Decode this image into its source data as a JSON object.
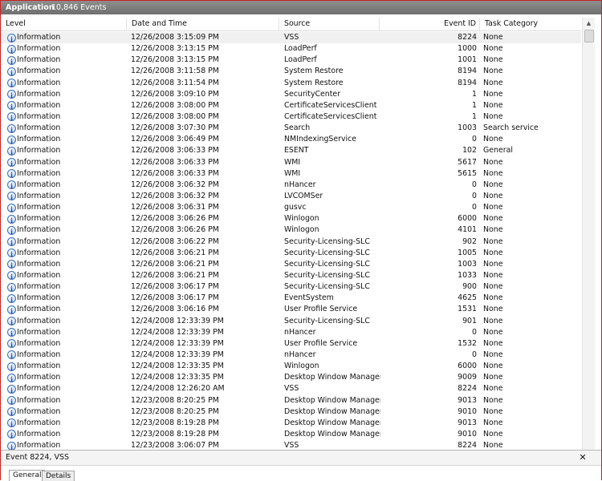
{
  "titlebar": {
    "app": "Application",
    "count": "10,846 Events"
  },
  "columns": {
    "level": "Level",
    "date": "Date and Time",
    "source": "Source",
    "event_id": "Event ID",
    "task": "Task Category"
  },
  "rows": [
    [
      "Information",
      "12/26/2008 3:15:09 PM",
      "VSS",
      "8224",
      "None"
    ],
    [
      "Information",
      "12/26/2008 3:13:15 PM",
      "LoadPerf",
      "1000",
      "None"
    ],
    [
      "Information",
      "12/26/2008 3:13:15 PM",
      "LoadPerf",
      "1001",
      "None"
    ],
    [
      "Information",
      "12/26/2008 3:11:58 PM",
      "System Restore",
      "8194",
      "None"
    ],
    [
      "Information",
      "12/26/2008 3:11:54 PM",
      "System Restore",
      "8194",
      "None"
    ],
    [
      "Information",
      "12/26/2008 3:09:10 PM",
      "SecurityCenter",
      "1",
      "None"
    ],
    [
      "Information",
      "12/26/2008 3:08:00 PM",
      "CertificateServicesClient",
      "1",
      "None"
    ],
    [
      "Information",
      "12/26/2008 3:08:00 PM",
      "CertificateServicesClient",
      "1",
      "None"
    ],
    [
      "Information",
      "12/26/2008 3:07:30 PM",
      "Search",
      "1003",
      "Search service"
    ],
    [
      "Information",
      "12/26/2008 3:06:49 PM",
      "NMIndexingService",
      "0",
      "None"
    ],
    [
      "Information",
      "12/26/2008 3:06:33 PM",
      "ESENT",
      "102",
      "General"
    ],
    [
      "Information",
      "12/26/2008 3:06:33 PM",
      "WMI",
      "5617",
      "None"
    ],
    [
      "Information",
      "12/26/2008 3:06:33 PM",
      "WMI",
      "5615",
      "None"
    ],
    [
      "Information",
      "12/26/2008 3:06:32 PM",
      "nHancer",
      "0",
      "None"
    ],
    [
      "Information",
      "12/26/2008 3:06:32 PM",
      "LVCOMSer",
      "0",
      "None"
    ],
    [
      "Information",
      "12/26/2008 3:06:31 PM",
      "gusvc",
      "0",
      "None"
    ],
    [
      "Information",
      "12/26/2008 3:06:26 PM",
      "Winlogon",
      "6000",
      "None"
    ],
    [
      "Information",
      "12/26/2008 3:06:26 PM",
      "Winlogon",
      "4101",
      "None"
    ],
    [
      "Information",
      "12/26/2008 3:06:22 PM",
      "Security-Licensing-SLC",
      "902",
      "None"
    ],
    [
      "Information",
      "12/26/2008 3:06:21 PM",
      "Security-Licensing-SLC",
      "1005",
      "None"
    ],
    [
      "Information",
      "12/26/2008 3:06:21 PM",
      "Security-Licensing-SLC",
      "1003",
      "None"
    ],
    [
      "Information",
      "12/26/2008 3:06:21 PM",
      "Security-Licensing-SLC",
      "1033",
      "None"
    ],
    [
      "Information",
      "12/26/2008 3:06:17 PM",
      "Security-Licensing-SLC",
      "900",
      "None"
    ],
    [
      "Information",
      "12/26/2008 3:06:17 PM",
      "EventSystem",
      "4625",
      "None"
    ],
    [
      "Information",
      "12/26/2008 3:06:16 PM",
      "User Profile Service",
      "1531",
      "None"
    ],
    [
      "Information",
      "12/24/2008 12:33:39 PM",
      "Security-Licensing-SLC",
      "901",
      "None"
    ],
    [
      "Information",
      "12/24/2008 12:33:39 PM",
      "nHancer",
      "0",
      "None"
    ],
    [
      "Information",
      "12/24/2008 12:33:39 PM",
      "User Profile Service",
      "1532",
      "None"
    ],
    [
      "Information",
      "12/24/2008 12:33:39 PM",
      "nHancer",
      "0",
      "None"
    ],
    [
      "Information",
      "12/24/2008 12:33:35 PM",
      "Winlogon",
      "6000",
      "None"
    ],
    [
      "Information",
      "12/24/2008 12:33:35 PM",
      "Desktop Window Manager",
      "9009",
      "None"
    ],
    [
      "Information",
      "12/24/2008 12:26:20 AM",
      "VSS",
      "8224",
      "None"
    ],
    [
      "Information",
      "12/23/2008 8:20:25 PM",
      "Desktop Window Manager",
      "9013",
      "None"
    ],
    [
      "Information",
      "12/23/2008 8:20:25 PM",
      "Desktop Window Manager",
      "9010",
      "None"
    ],
    [
      "Information",
      "12/23/2008 8:19:28 PM",
      "Desktop Window Manager",
      "9013",
      "None"
    ],
    [
      "Information",
      "12/23/2008 8:19:28 PM",
      "Desktop Window Manager",
      "9010",
      "None"
    ],
    [
      "Information",
      "12/23/2008 3:06:07 PM",
      "VSS",
      "8224",
      "None"
    ]
  ],
  "detail": {
    "title": "Event 8224, VSS",
    "close": "✕",
    "tabs": [
      "General",
      "Details"
    ]
  },
  "scrollbar": {
    "up_arrow": "▲"
  },
  "colors": {
    "frame": "#cc1f1f",
    "titlebar": "#7f7f7f",
    "selected_row": "#f0f0f0",
    "info_icon": "#3d6fb6"
  }
}
